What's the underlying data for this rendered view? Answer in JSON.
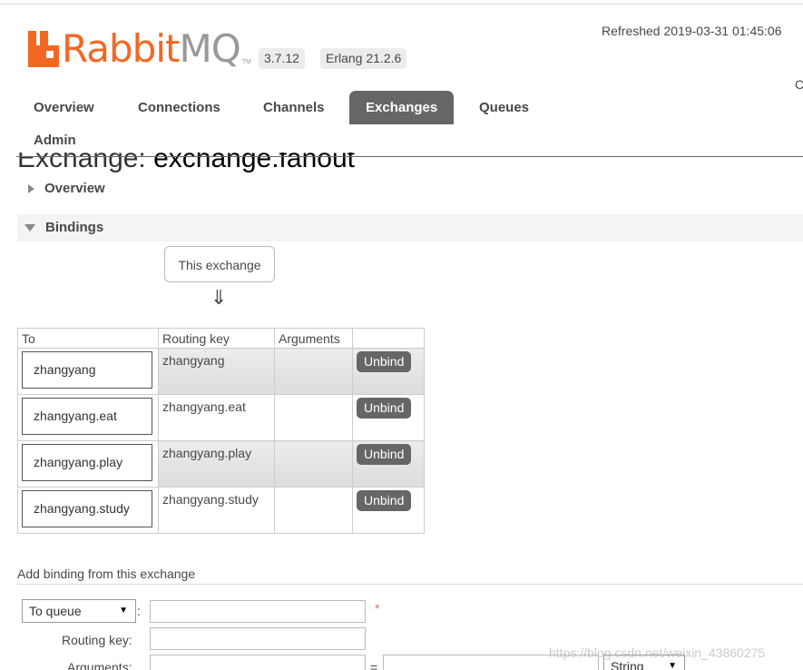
{
  "header": {
    "logo_rabbit": "Rabbit",
    "logo_mq": "MQ",
    "logo_tm": "TM",
    "version": "3.7.12",
    "erlang": "Erlang 21.2.6",
    "refreshed": "Refreshed 2019-03-31 01:45:06",
    "right_cut": "C"
  },
  "nav": {
    "tabs": [
      {
        "label": "Overview"
      },
      {
        "label": "Connections"
      },
      {
        "label": "Channels"
      },
      {
        "label": "Exchanges"
      },
      {
        "label": "Queues"
      },
      {
        "label": "Admin"
      }
    ],
    "active": "Exchanges"
  },
  "page": {
    "title_prefix": "Exchange: ",
    "title_name": "exchange.fanout"
  },
  "sections": {
    "overview": "Overview",
    "bindings": "Bindings"
  },
  "bindings": {
    "source_label": "This exchange",
    "arrow": "⇓",
    "columns": [
      "To",
      "Routing key",
      "Arguments",
      ""
    ],
    "unbind_label": "Unbind",
    "rows": [
      {
        "to": "zhangyang",
        "routing_key": "zhangyang",
        "arguments": ""
      },
      {
        "to": "zhangyang.eat",
        "routing_key": "zhangyang.eat",
        "arguments": ""
      },
      {
        "to": "zhangyang.play",
        "routing_key": "zhangyang.play",
        "arguments": ""
      },
      {
        "to": "zhangyang.study",
        "routing_key": "zhangyang.study",
        "arguments": ""
      }
    ]
  },
  "add_binding": {
    "title": "Add binding from this exchange",
    "destination_type": "To queue",
    "destination_value": "",
    "required_mark": "*",
    "routing_key_label": "Routing key:",
    "routing_key_value": "",
    "arguments_label": "Arguments:",
    "argument_key": "",
    "argument_value": "",
    "argument_type": "String"
  },
  "watermark": "https://blog.csdn.net/weixin_43860275"
}
